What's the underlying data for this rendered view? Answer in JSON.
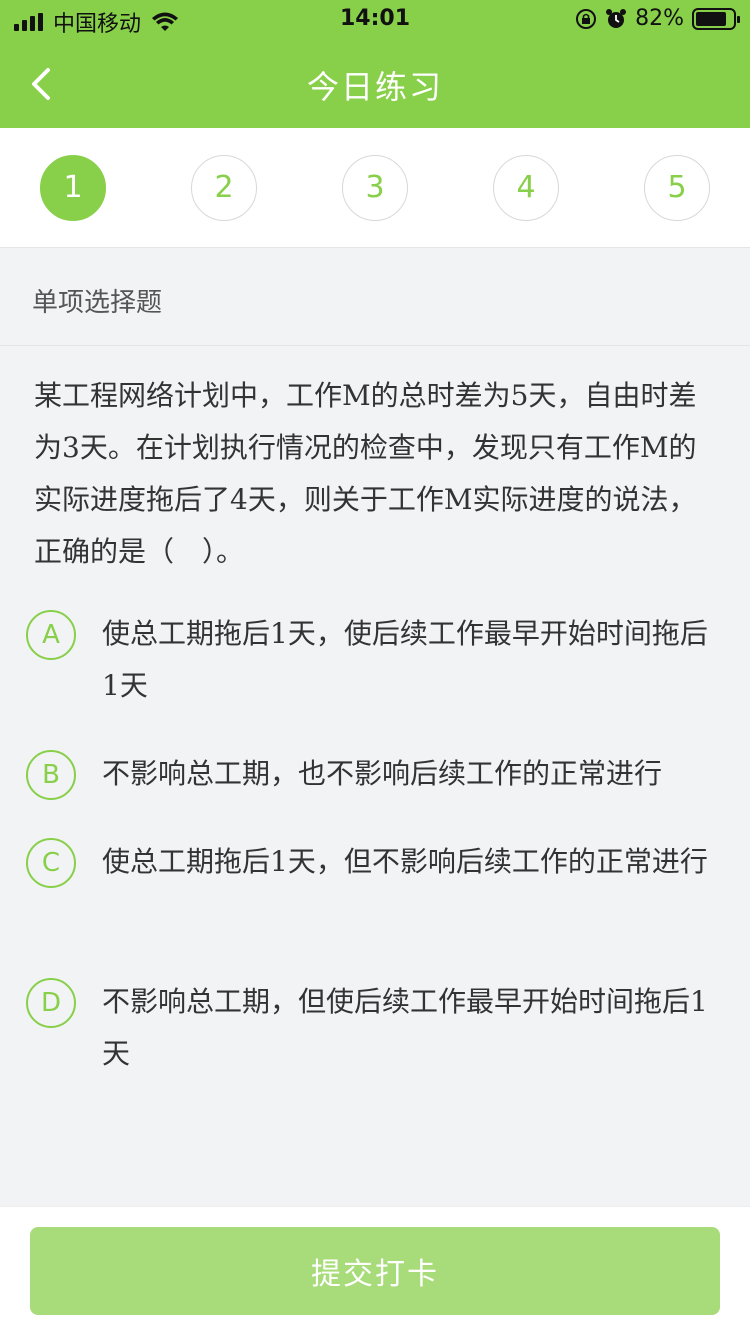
{
  "status_bar": {
    "carrier": "中国移动",
    "time": "14:01",
    "battery_percent": "82%",
    "battery_level": 0.82,
    "icons": [
      "signal-icon",
      "wifi-icon",
      "rotation-lock-icon",
      "alarm-icon",
      "battery-icon"
    ]
  },
  "nav": {
    "title": "今日练习",
    "back_icon": "chevron-left-icon"
  },
  "colors": {
    "accent": "#88cf4a",
    "submit_disabled": "#a8dc7a",
    "background": "#f2f3f5"
  },
  "steps": [
    {
      "label": "1",
      "active": true
    },
    {
      "label": "2",
      "active": false
    },
    {
      "label": "3",
      "active": false
    },
    {
      "label": "4",
      "active": false
    },
    {
      "label": "5",
      "active": false
    }
  ],
  "question": {
    "type": "单项选择题",
    "text": "某工程网络计划中，工作M的总时差为5天，自由时差为3天。在计划执行情况的检查中，发现只有工作M的实际进度拖后了4天，则关于工作M实际进度的说法，正确的是（　）。",
    "options": [
      {
        "letter": "A",
        "text": "使总工期拖后1天，使后续工作最早开始时间拖后1天"
      },
      {
        "letter": "B",
        "text": "不影响总工期，也不影响后续工作的正常进行"
      },
      {
        "letter": "C",
        "text": "使总工期拖后1天，但不影响后续工作的正常进行"
      },
      {
        "letter": "D",
        "text": "不影响总工期，但使后续工作最早开始时间拖后1天"
      }
    ]
  },
  "footer": {
    "submit_label": "提交打卡"
  }
}
